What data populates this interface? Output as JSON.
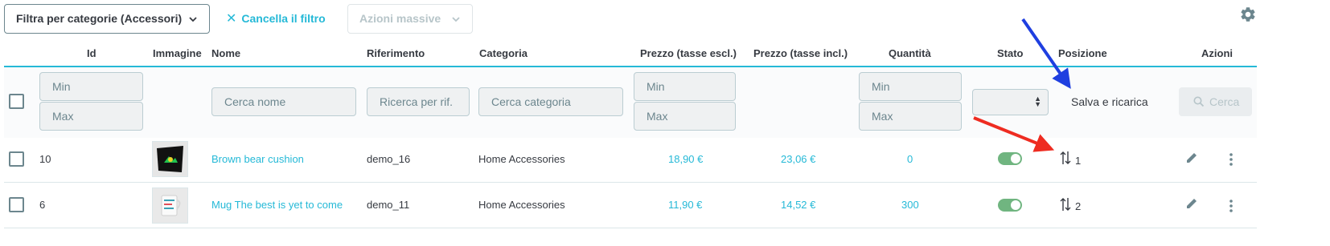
{
  "toolbar": {
    "filter_label": "Filtra per categorie (Accessori)",
    "clear_label": "Cancella il filtro",
    "bulk_label": "Azioni massive"
  },
  "columns": {
    "id": "Id",
    "image": "Immagine",
    "name": "Nome",
    "reference": "Riferimento",
    "category": "Categoria",
    "price_excl": "Prezzo (tasse escl.)",
    "price_incl": "Prezzo (tasse incl.)",
    "quantity": "Quantità",
    "status": "Stato",
    "position": "Posizione",
    "actions": "Azioni"
  },
  "filters": {
    "id_min": "Min",
    "id_max": "Max",
    "name_placeholder": "Cerca nome",
    "reference_placeholder": "Ricerca per rif.",
    "category_placeholder": "Cerca categoria",
    "price_min": "Min",
    "price_max": "Max",
    "qty_min": "Min",
    "qty_max": "Max",
    "save_reload": "Salva e ricarica",
    "search_label": "Cerca"
  },
  "rows": [
    {
      "id": "10",
      "name": "Brown bear cushion",
      "reference": "demo_16",
      "category": "Home Accessories",
      "price_excl": "18,90 €",
      "price_incl": "23,06 €",
      "quantity": "0",
      "status": "on",
      "position": "1"
    },
    {
      "id": "6",
      "name": "Mug The best is yet to come",
      "reference": "demo_11",
      "category": "Home Accessories",
      "price_excl": "11,90 €",
      "price_incl": "14,52 €",
      "quantity": "300",
      "status": "on",
      "position": "2"
    }
  ],
  "colors": {
    "accent": "#25b9d7",
    "toggle_on": "#70b580",
    "annotation_blue": "#1f3fe0",
    "annotation_red": "#ee2c21"
  }
}
